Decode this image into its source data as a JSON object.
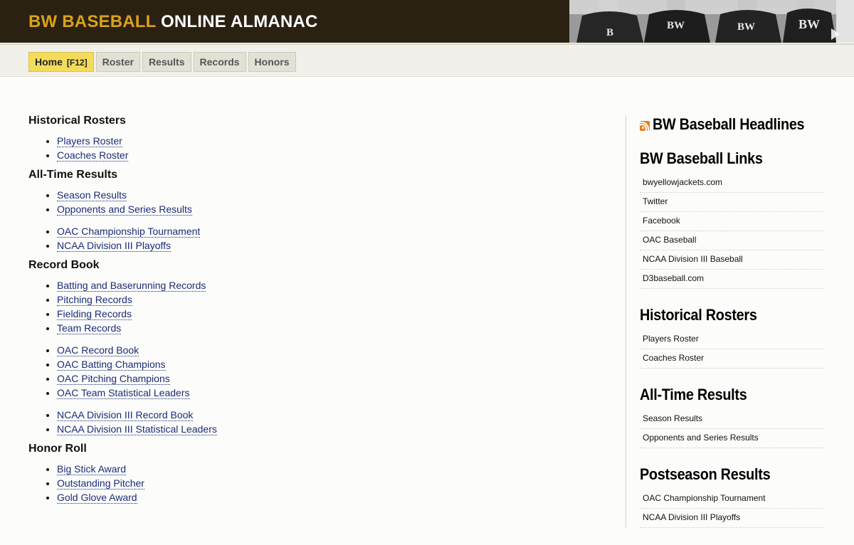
{
  "header": {
    "title_part1": "BW BASEBALL",
    "title_part2": "ONLINE ALMANAC",
    "photo_jersey_letters": [
      "B",
      "BW",
      "BW",
      "BW"
    ]
  },
  "nav": {
    "tabs": [
      {
        "label": "Home",
        "key": "[F12]",
        "active": true
      },
      {
        "label": "Roster"
      },
      {
        "label": "Results"
      },
      {
        "label": "Records"
      },
      {
        "label": "Honors"
      }
    ]
  },
  "main": {
    "sections": [
      {
        "heading": "Historical Rosters",
        "groups": [
          [
            "Players Roster",
            "Coaches Roster"
          ]
        ]
      },
      {
        "heading": "All-Time Results",
        "groups": [
          [
            "Season Results",
            "Opponents and Series Results"
          ],
          [
            "OAC Championship Tournament",
            "NCAA Division III Playoffs"
          ]
        ]
      },
      {
        "heading": "Record Book",
        "groups": [
          [
            "Batting and Baserunning Records",
            "Pitching Records",
            "Fielding Records",
            "Team Records"
          ],
          [
            "OAC Record Book",
            "OAC Batting Champions",
            "OAC Pitching Champions",
            "OAC Team Statistical Leaders"
          ],
          [
            "NCAA Division III Record Book",
            "NCAA Division III Statistical Leaders"
          ]
        ]
      },
      {
        "heading": "Honor Roll",
        "groups": [
          [
            "Big Stick Award",
            "Outstanding Pitcher",
            "Gold Glove Award"
          ]
        ]
      }
    ]
  },
  "sidebar": {
    "headlines_title": "BW Baseball Headlines",
    "rss_icon": "rss-icon",
    "blocks": [
      {
        "title": "BW Baseball Links",
        "links": [
          "bwyellowjackets.com",
          "Twitter",
          "Facebook",
          "OAC Baseball",
          "NCAA Division III Baseball",
          "D3baseball.com"
        ]
      },
      {
        "title": "Historical Rosters",
        "links": [
          "Players Roster",
          "Coaches Roster"
        ]
      },
      {
        "title": "All-Time Results",
        "links": [
          "Season Results",
          "Opponents and Series Results"
        ]
      },
      {
        "title": "Postseason Results",
        "links": [
          "OAC Championship Tournament",
          "NCAA Division III Playoffs"
        ]
      }
    ]
  },
  "colors": {
    "header_bg": "#2a2112",
    "title_gold": "#d9a21b",
    "active_tab": "#f3dc5b",
    "link": "#1a2c78"
  }
}
